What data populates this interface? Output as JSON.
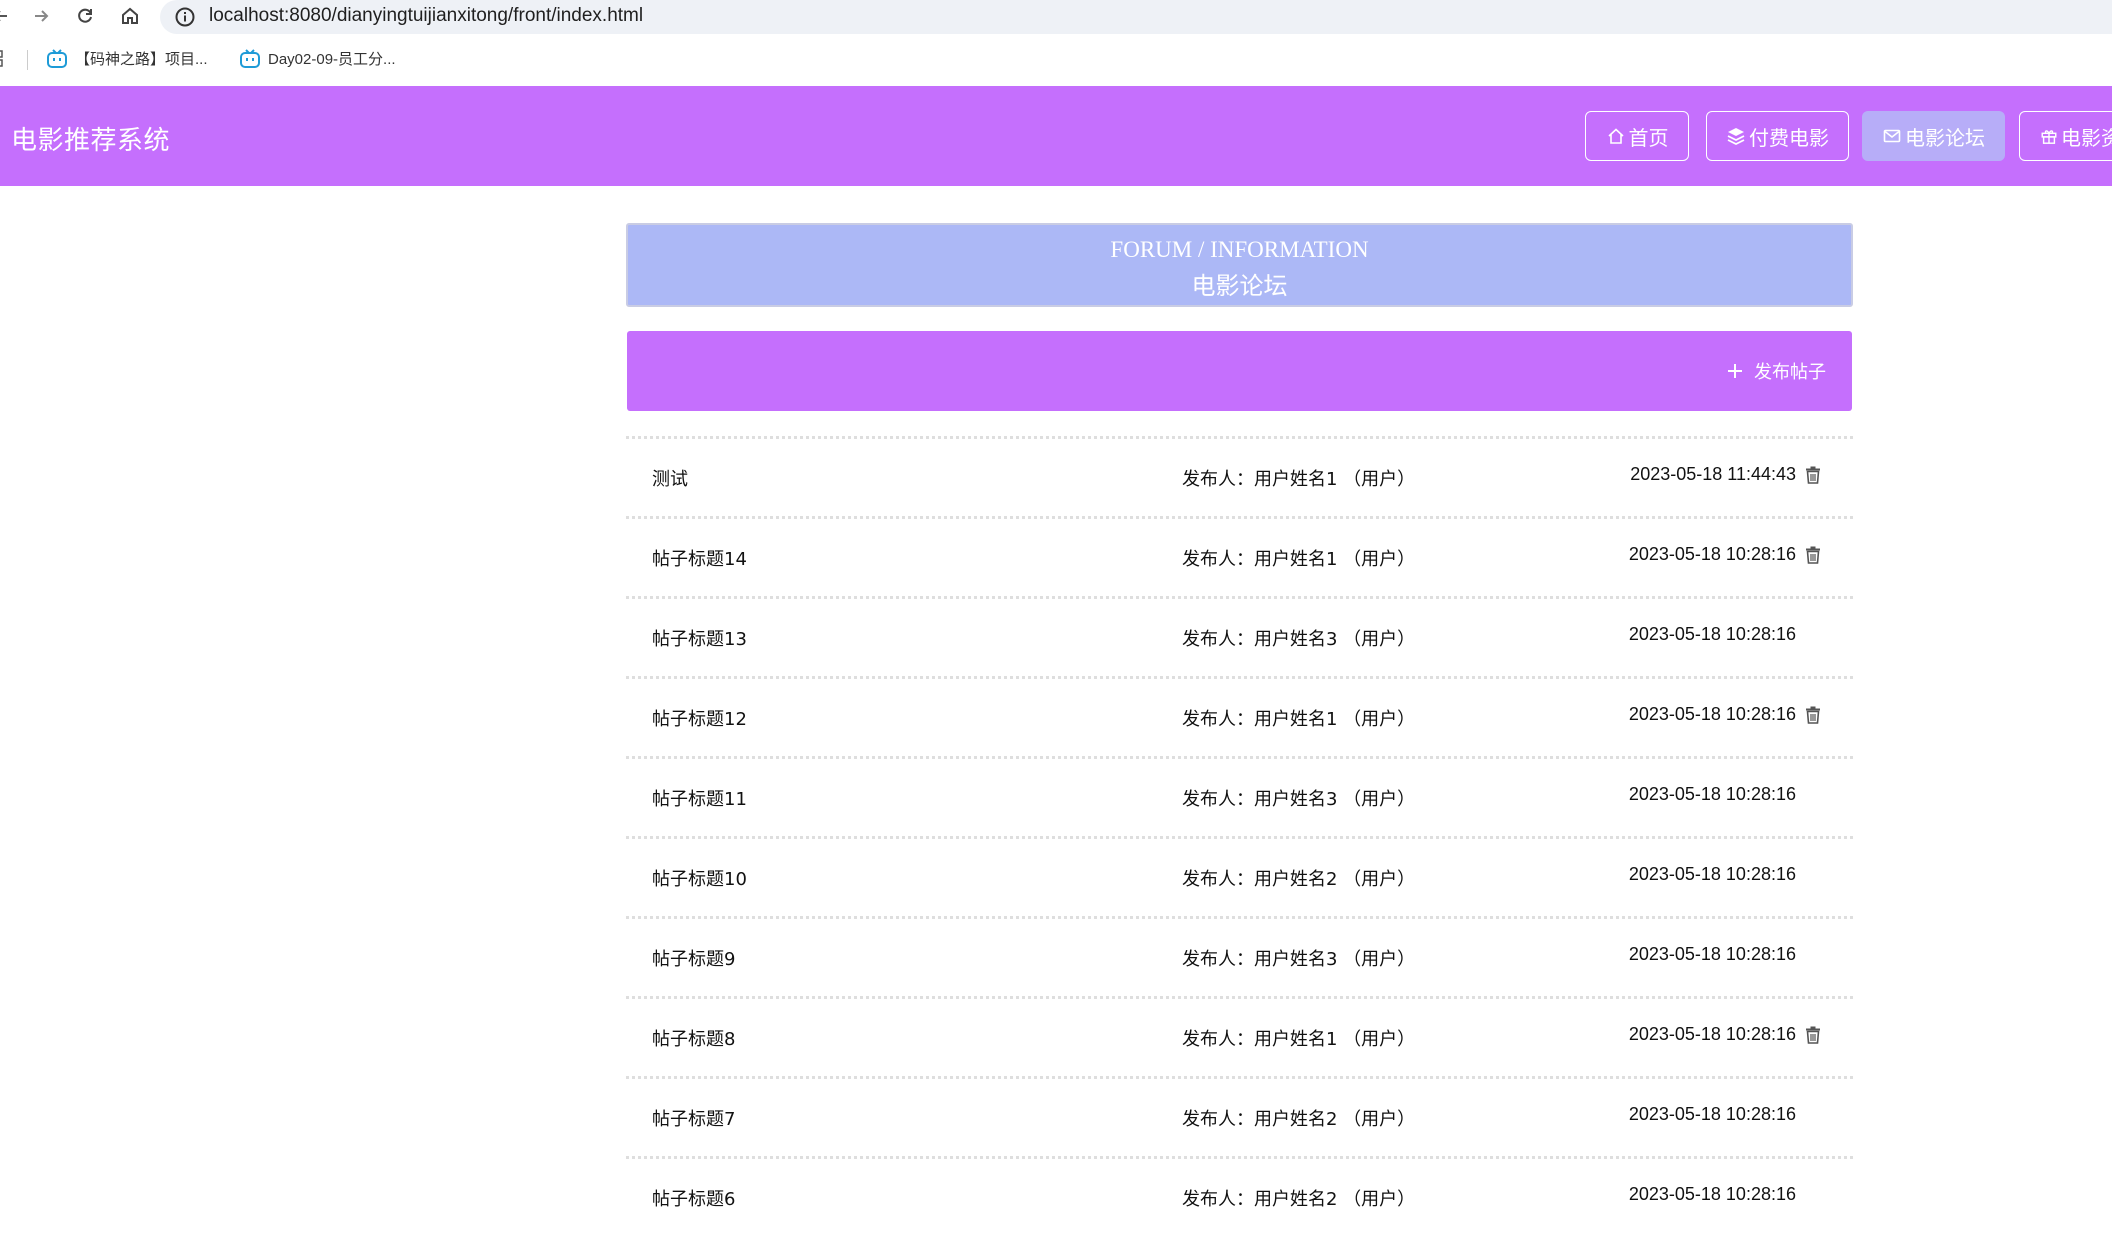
{
  "browser": {
    "url": "localhost:8080/dianyingtuijianxitong/front/index.html",
    "bookmarks": [
      {
        "label": "【码神之路】项目..."
      },
      {
        "label": "Day02-09-员工分..."
      }
    ]
  },
  "header": {
    "title": "电影推荐系统",
    "nav": [
      {
        "label": "首页",
        "icon": "home-icon"
      },
      {
        "label": "付费电影",
        "icon": "layers-icon"
      },
      {
        "label": "电影论坛",
        "icon": "message-icon",
        "active": true
      },
      {
        "label": "电影资",
        "icon": "gift-icon"
      }
    ]
  },
  "banner": {
    "en": "FORUM / INFORMATION",
    "cn": "电影论坛"
  },
  "actions": {
    "publish_label": "发布帖子"
  },
  "posts": [
    {
      "title": "测试",
      "author": "发布人：用户姓名1 （用户）",
      "time": "2023-05-18 11:44:43",
      "deletable": true
    },
    {
      "title": "帖子标题14",
      "author": "发布人：用户姓名1 （用户）",
      "time": "2023-05-18 10:28:16",
      "deletable": true
    },
    {
      "title": "帖子标题13",
      "author": "发布人：用户姓名3 （用户）",
      "time": "2023-05-18 10:28:16",
      "deletable": false
    },
    {
      "title": "帖子标题12",
      "author": "发布人：用户姓名1 （用户）",
      "time": "2023-05-18 10:28:16",
      "deletable": true
    },
    {
      "title": "帖子标题11",
      "author": "发布人：用户姓名3 （用户）",
      "time": "2023-05-18 10:28:16",
      "deletable": false
    },
    {
      "title": "帖子标题10",
      "author": "发布人：用户姓名2 （用户）",
      "time": "2023-05-18 10:28:16",
      "deletable": false
    },
    {
      "title": "帖子标题9",
      "author": "发布人：用户姓名3 （用户）",
      "time": "2023-05-18 10:28:16",
      "deletable": false
    },
    {
      "title": "帖子标题8",
      "author": "发布人：用户姓名1 （用户）",
      "time": "2023-05-18 10:28:16",
      "deletable": true
    },
    {
      "title": "帖子标题7",
      "author": "发布人：用户姓名2 （用户）",
      "time": "2023-05-18 10:28:16",
      "deletable": false
    },
    {
      "title": "帖子标题6",
      "author": "发布人：用户姓名2 （用户）",
      "time": "2023-05-18 10:28:16",
      "deletable": false
    }
  ],
  "colors": {
    "header": "#c56ffd",
    "banner": "#acb8f6",
    "nav_active": "#b7adf8"
  }
}
